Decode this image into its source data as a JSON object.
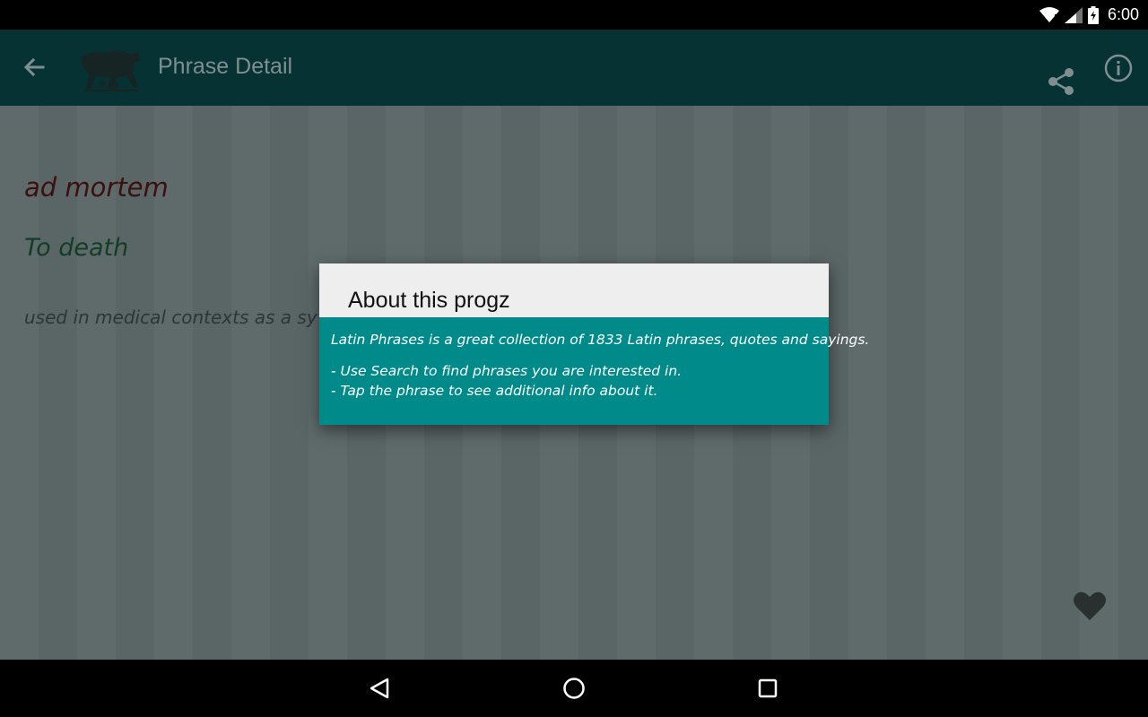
{
  "status_bar": {
    "time": "6:00",
    "icons": [
      "wifi-icon",
      "signal-icon",
      "battery-charging-icon"
    ]
  },
  "app_bar": {
    "title": "Phrase Detail",
    "back_icon": "arrow-back-icon",
    "logo": "she-wolf-logo",
    "actions": [
      "share-icon",
      "info-icon"
    ]
  },
  "phrase": {
    "latin": "ad mortem",
    "translation": "To death",
    "note": "used in medical contexts as a sy"
  },
  "favorite_icon": "heart-icon",
  "dialog": {
    "title": "About this progz",
    "line1": "Latin Phrases is a great collection of 1833 Latin phrases, quotes and sayings.",
    "line2": "- Use Search to find phrases you are interested in.",
    "line3": "- Tap the phrase to see additional info about it."
  },
  "nav_bar": {
    "buttons": [
      "back-triangle-icon",
      "home-circle-icon",
      "recents-square-icon"
    ]
  },
  "colors": {
    "app_bar": "#063234",
    "dialog_body": "#008b8a",
    "phrase": "#3c0f10",
    "translation": "#133d24"
  }
}
